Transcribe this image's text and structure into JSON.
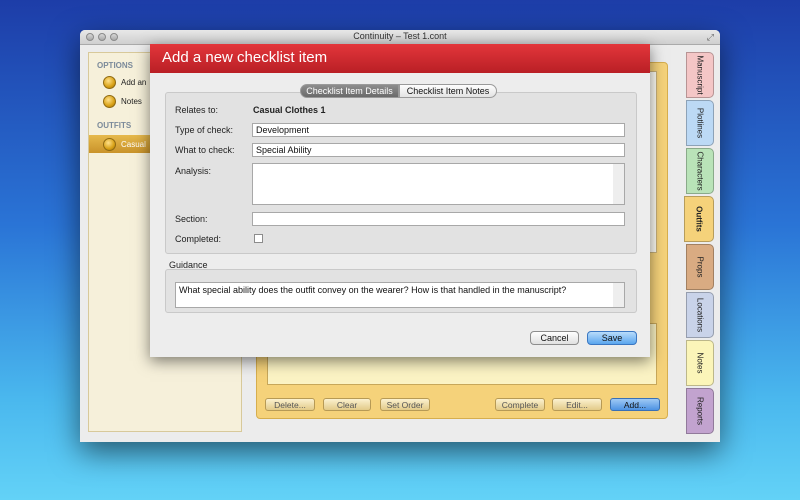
{
  "window": {
    "title": "Continuity – Test 1.cont"
  },
  "sidebar": {
    "options_header": "OPTIONS",
    "options": [
      {
        "label": "Add an",
        "icon": "coin-icon"
      },
      {
        "label": "Notes",
        "icon": "coin-icon"
      }
    ],
    "outfits_header": "OUTFITS",
    "outfits": [
      {
        "label": "Casual",
        "icon": "coin-icon"
      }
    ]
  },
  "background_buttons": {
    "delete": "Delete...",
    "clear": "Clear",
    "set_order": "Set Order",
    "complete": "Complete",
    "edit": "Edit...",
    "add": "Add..."
  },
  "right_tabs": [
    {
      "label": "Manuscript",
      "color": "#f4c6c6"
    },
    {
      "label": "Plotlines",
      "color": "#bcd9f5"
    },
    {
      "label": "Characters",
      "color": "#b9e3b8"
    },
    {
      "label": "Outfits",
      "color": "#f5d27a"
    },
    {
      "label": "Props",
      "color": "#d9ab82"
    },
    {
      "label": "Locations",
      "color": "#c9d3e9"
    },
    {
      "label": "Notes",
      "color": "#fbf5b9"
    },
    {
      "label": "Reports",
      "color": "#c2a3cf"
    }
  ],
  "dialog": {
    "title": "Add a new checklist item",
    "tabs": {
      "details": "Checklist Item Details",
      "notes": "Checklist Item Notes"
    },
    "relates_to_label": "Relates to:",
    "relates_to_value": "Casual Clothes 1",
    "type_label": "Type of check:",
    "type_value": "Development",
    "what_label": "What to check:",
    "what_value": "Special Ability",
    "analysis_label": "Analysis:",
    "analysis_value": "",
    "section_label": "Section:",
    "section_value": "",
    "completed_label": "Completed:",
    "completed_checked": false,
    "guidance_label": "Guidance",
    "guidance_text": "What special ability does the outfit convey on the wearer? How is that handled in the manuscript?",
    "cancel": "Cancel",
    "save": "Save"
  },
  "colors": {
    "dialog_header": "#c9252b",
    "outfits_panel": "#f5d27a",
    "primary_button": "#5aa6ee"
  }
}
